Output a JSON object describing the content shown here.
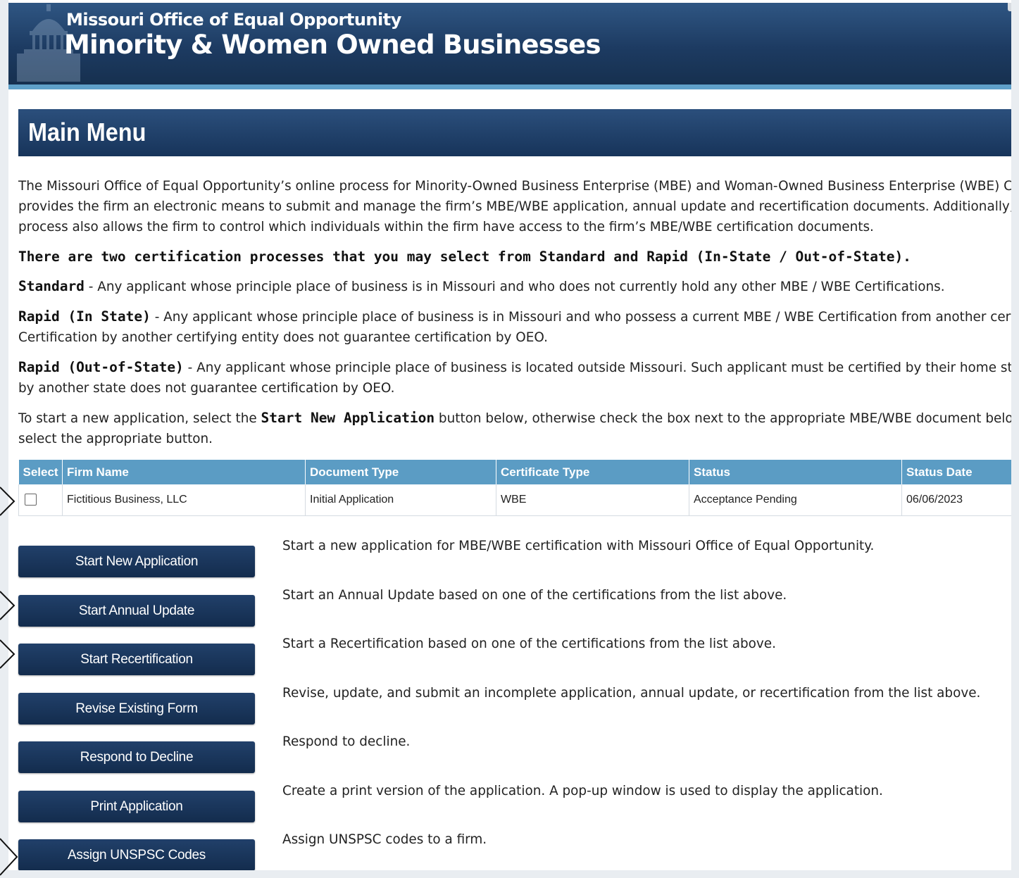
{
  "header": {
    "subtitle": "Missouri Office of Equal Opportunity",
    "title": "Minority & Women Owned Businesses"
  },
  "main_menu": {
    "title": "Main Menu"
  },
  "intro": {
    "p1_lines": [
      "The Missouri Office of Equal Opportunity’s online process for Minority-Owned Business Enterprise (MBE) and Woman-Owned Business Enterprise (WBE) Certificatio",
      "provides the firm an electronic means to submit and manage the firm’s MBE/WBE application, annual update and recertification documents. Additionally, the online",
      "process also allows the firm to control which individuals within the firm have access to the firm’s MBE/WBE certification documents."
    ],
    "heading": "There are two certification processes that you may select from Standard and Rapid (In-State / Out-of-State).",
    "standard_label": "Standard",
    "standard_text": " - Any applicant whose principle place of business is in Missouri and who does not currently hold any other MBE / WBE Certifications.",
    "rapid_in_label": "Rapid (In State)",
    "rapid_in_text1": " - Any applicant whose principle place of business is in Missouri and who possess a current MBE / WBE Certification from another certifying entit",
    "rapid_in_text2": "Certification by another certifying entity does not guarantee certification by OEO.",
    "rapid_out_label": "Rapid (Out-of-State)",
    "rapid_out_text1": " - Any applicant whose principle place of business is located outside Missouri. Such applicant must be certified by their home state. Certific",
    "rapid_out_text2": "by another state does not guarantee certification by OEO.",
    "instr_pre": "To start a new application, select the ",
    "instr_bold": "Start New Application",
    "instr_post": " button below, otherwise check the box next to the appropriate MBE/WBE document below and ther",
    "instr_line2": "select the appropriate button."
  },
  "table": {
    "headers": [
      "Select",
      "Firm Name",
      "Document Type",
      "Certificate Type",
      "Status",
      "Status Date"
    ],
    "rows": [
      {
        "selected": false,
        "firm_name": "Fictitious Business, LLC",
        "document_type": "Initial Application",
        "certificate_type": "WBE",
        "status": "Acceptance Pending",
        "status_date": "06/06/2023"
      }
    ]
  },
  "actions": [
    {
      "label": "Start New Application",
      "description": "Start a new application for MBE/WBE certification with Missouri Office of Equal Opportunity."
    },
    {
      "label": "Start Annual Update",
      "description": "Start an Annual Update based on one of the certifications from the list above."
    },
    {
      "label": "Start Recertification",
      "description": "Start a Recertification based on one of the certifications from the list above."
    },
    {
      "label": "Revise Existing Form",
      "description": "Revise, update, and submit an incomplete application, annual update, or recertification from the list above."
    },
    {
      "label": "Respond to Decline",
      "description": "Respond to decline."
    },
    {
      "label": "Print Application",
      "description": "Create a print version of the application. A pop-up window is used to display the application."
    },
    {
      "label": "Assign UNSPSC Codes",
      "description": "Assign UNSPSC codes to a firm."
    }
  ],
  "colors": {
    "banner": "#1d3b62",
    "stripe": "#5fa0c9",
    "table_header": "#5b9cc4",
    "button": "#1a375e"
  },
  "icons": {
    "annotation": "right-arrow-icon",
    "header_logo": "capitol-building-icon"
  }
}
